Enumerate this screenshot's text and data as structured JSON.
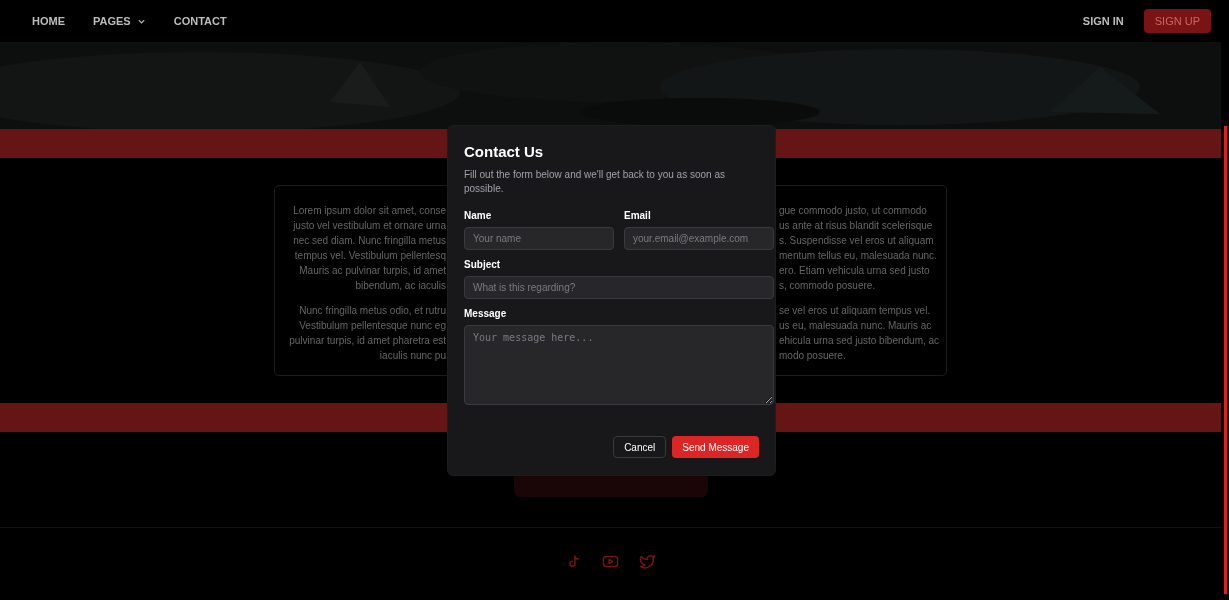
{
  "nav": {
    "links": [
      {
        "label": "HOME",
        "dropdown": false
      },
      {
        "label": "PAGES",
        "dropdown": true
      },
      {
        "label": "CONTACT",
        "dropdown": false
      }
    ],
    "sign_in": "SIGN IN",
    "sign_up": "SIGN UP"
  },
  "card": {
    "paragraphs": [
      {
        "left": [
          "Lorem ipsum dolor sit amet, conse",
          "justo vel vestibulum et ornare urna",
          "nec sed diam. Nunc fringilla metus",
          "tempus vel. Vestibulum pellentesq",
          "Mauris ac pulvinar turpis, id amet",
          "bibendum, ac iaculis"
        ],
        "right": [
          "gue commodo justo, ut commodo",
          "us ante at risus blandit scelerisque",
          "s. Suspendisse vel eros ut aliquam",
          "mentum tellus eu, malesuada nunc.",
          "ero. Etiam vehicula urna sed justo",
          "s, commodo posuere."
        ]
      },
      {
        "left": [
          "Nunc fringilla metus odio, et rutru",
          "Vestibulum pellentesque nunc eg",
          "pulvinar turpis, id amet pharetra est",
          "iaculis nunc pu"
        ],
        "right": [
          "se vel eros ut aliquam tempus vel.",
          "us eu, malesuada nunc. Mauris ac",
          "ehicula urna sed justo bibendum, ac",
          "modo posuere."
        ]
      }
    ]
  },
  "footer": {
    "social": [
      {
        "kind": "tiktok"
      },
      {
        "kind": "youtube"
      },
      {
        "kind": "twitter"
      }
    ]
  },
  "modal": {
    "title": "Contact Us",
    "description": "Fill out the form below and we'll get back to you as soon as possible.",
    "fields": [
      {
        "label": "Name",
        "placeholder": "Your name",
        "kind": "half"
      },
      {
        "label": "Email",
        "placeholder": "your.email@example.com",
        "kind": "half"
      },
      {
        "label": "Subject",
        "placeholder": "What is this regarding?",
        "kind": "full"
      },
      {
        "label": "Message",
        "placeholder": "Your message here...",
        "kind": "textarea"
      }
    ],
    "cancel": "Cancel",
    "submit": "Send Message"
  }
}
